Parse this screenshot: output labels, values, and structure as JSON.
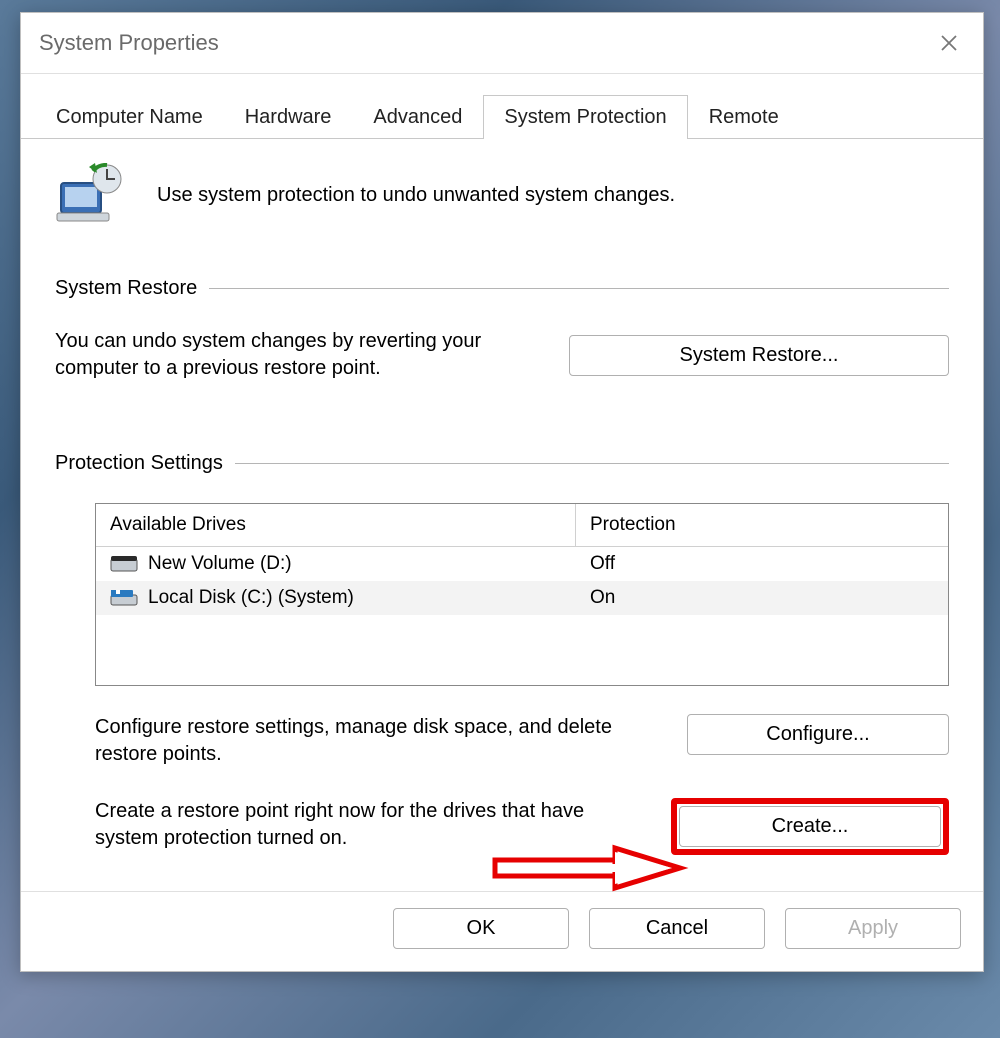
{
  "window": {
    "title": "System Properties"
  },
  "tabs": {
    "0": {
      "label": "Computer Name"
    },
    "1": {
      "label": "Hardware"
    },
    "2": {
      "label": "Advanced"
    },
    "3": {
      "label": "System Protection"
    },
    "4": {
      "label": "Remote"
    }
  },
  "intro_text": "Use system protection to undo unwanted system changes.",
  "system_restore": {
    "heading": "System Restore",
    "description": "You can undo system changes by reverting your computer to a previous restore point.",
    "button_label": "System Restore..."
  },
  "protection_settings": {
    "heading": "Protection Settings",
    "columns": {
      "available": "Available Drives",
      "protection": "Protection"
    },
    "drives": {
      "0": {
        "name": "New Volume (D:)",
        "protection": "Off"
      },
      "1": {
        "name": "Local Disk (C:) (System)",
        "protection": "On"
      }
    },
    "configure_text": "Configure restore settings, manage disk space, and delete restore points.",
    "configure_button": "Configure...",
    "create_text": "Create a restore point right now for the drives that have system protection turned on.",
    "create_button": "Create..."
  },
  "dialog_buttons": {
    "ok": "OK",
    "cancel": "Cancel",
    "apply": "Apply"
  }
}
